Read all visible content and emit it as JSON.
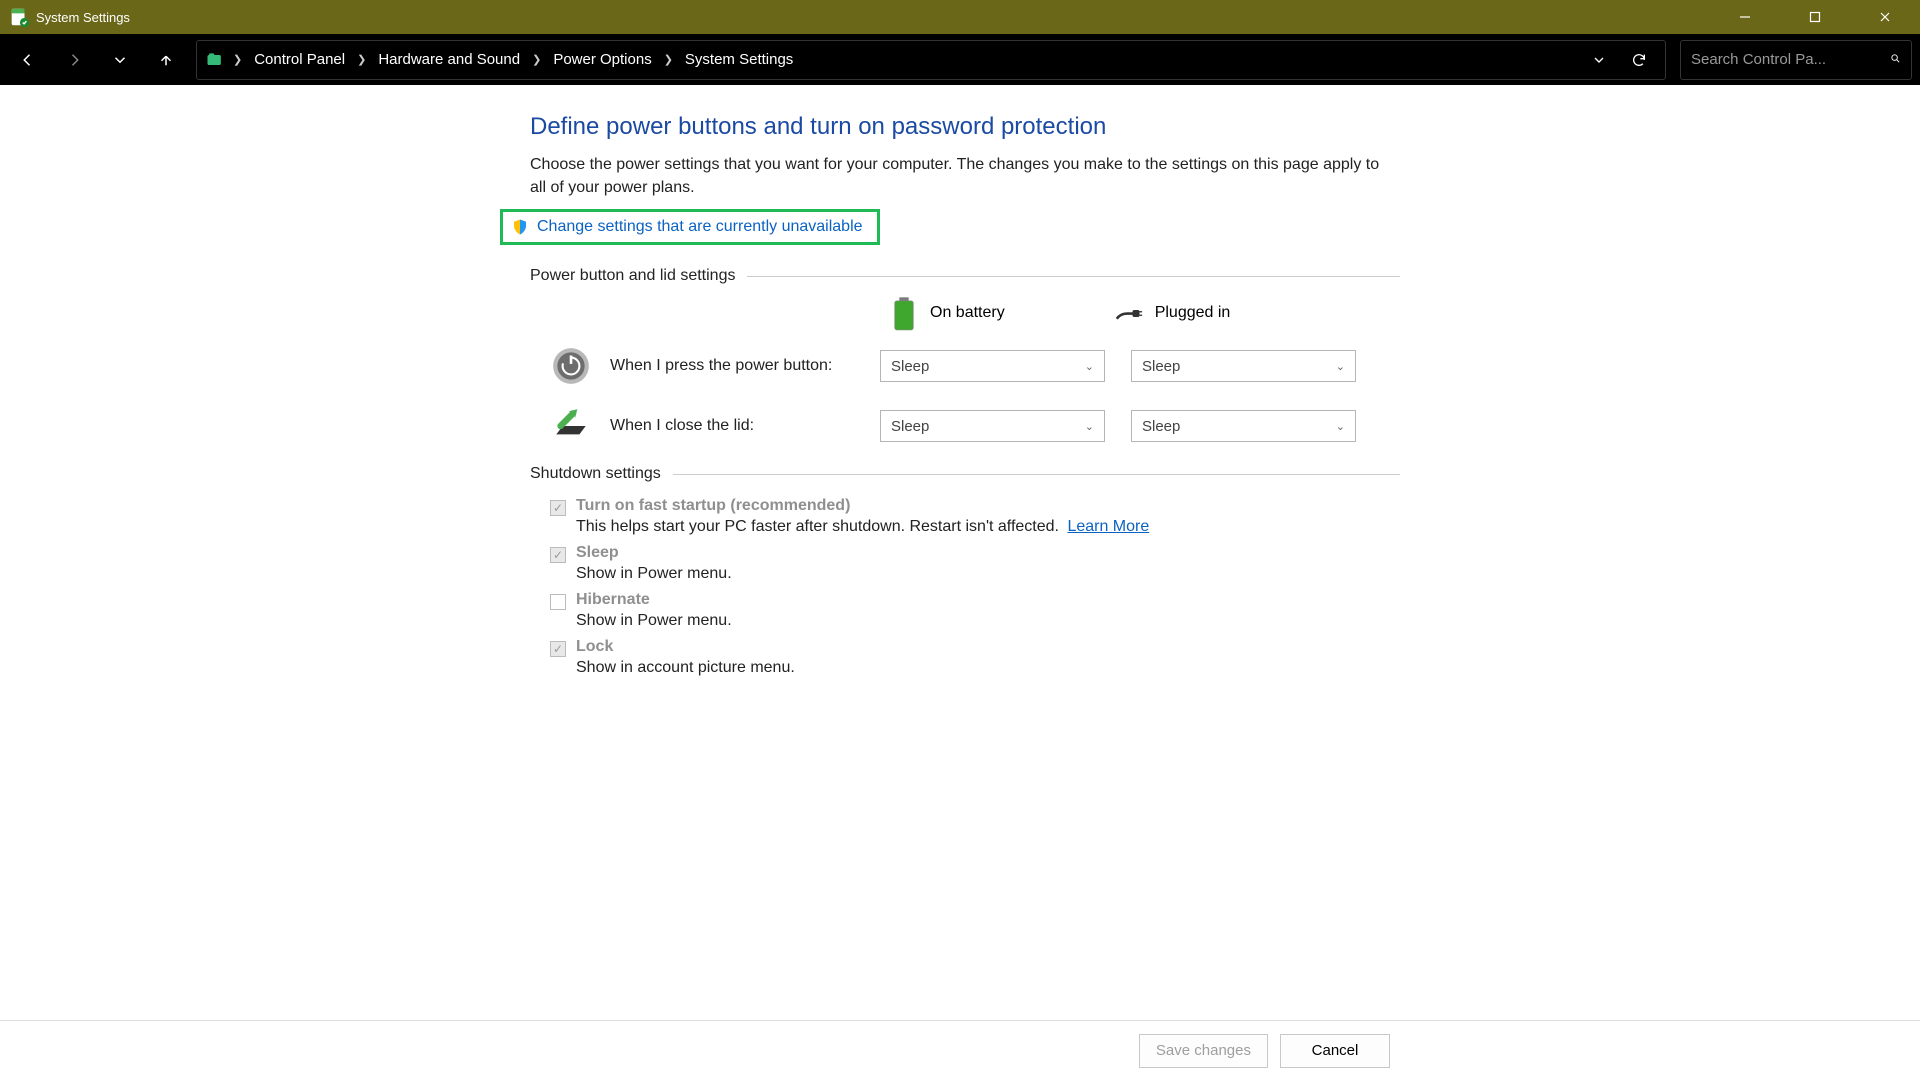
{
  "window": {
    "title": "System Settings"
  },
  "breadcrumb": {
    "items": [
      "Control Panel",
      "Hardware and Sound",
      "Power Options",
      "System Settings"
    ]
  },
  "search": {
    "placeholder": "Search Control Pa..."
  },
  "page": {
    "heading": "Define power buttons and turn on password protection",
    "description": "Choose the power settings that you want for your computer. The changes you make to the settings on this page apply to all of your power plans.",
    "change_link": "Change settings that are currently unavailable"
  },
  "sections": {
    "power_button": {
      "label": "Power button and lid settings",
      "columns": {
        "battery": "On battery",
        "plugged": "Plugged in"
      },
      "rows": [
        {
          "label": "When I press the power button:",
          "battery_value": "Sleep",
          "plugged_value": "Sleep"
        },
        {
          "label": "When I close the lid:",
          "battery_value": "Sleep",
          "plugged_value": "Sleep"
        }
      ]
    },
    "shutdown": {
      "label": "Shutdown settings",
      "items": [
        {
          "title": "Turn on fast startup (recommended)",
          "desc": "This helps start your PC faster after shutdown. Restart isn't affected.",
          "learn_more": "Learn More",
          "checked": true
        },
        {
          "title": "Sleep",
          "desc": "Show in Power menu.",
          "checked": true
        },
        {
          "title": "Hibernate",
          "desc": "Show in Power menu.",
          "checked": false
        },
        {
          "title": "Lock",
          "desc": "Show in account picture menu.",
          "checked": true
        }
      ]
    }
  },
  "footer": {
    "save": "Save changes",
    "cancel": "Cancel"
  }
}
